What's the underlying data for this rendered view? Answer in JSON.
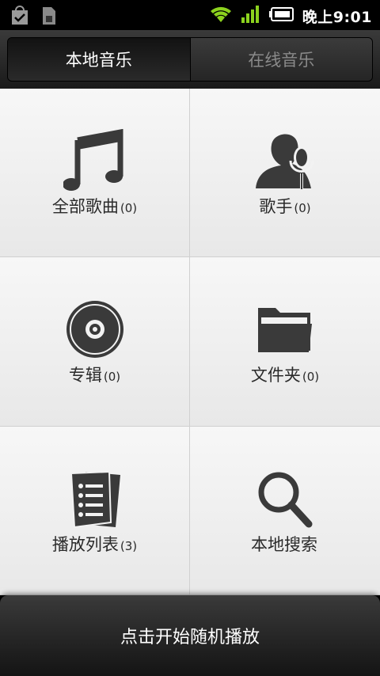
{
  "status_bar": {
    "time": "晚上9:01",
    "icons": [
      "shopping-bag-check-icon",
      "sim-card-icon",
      "wifi-icon",
      "signal-bars-icon",
      "battery-icon"
    ],
    "accent_color": "#8cd21e"
  },
  "tabs": [
    {
      "label": "本地音乐",
      "active": true
    },
    {
      "label": "在线音乐",
      "active": false
    }
  ],
  "grid": {
    "items": [
      {
        "label": "全部歌曲",
        "count": "(0)",
        "icon": "music-note-icon"
      },
      {
        "label": "歌手",
        "count": "(0)",
        "icon": "singer-microphone-icon"
      },
      {
        "label": "专辑",
        "count": "(0)",
        "icon": "disc-icon"
      },
      {
        "label": "文件夹",
        "count": "(0)",
        "icon": "folder-icon"
      },
      {
        "label": "播放列表",
        "count": "(3)",
        "icon": "playlist-icon"
      },
      {
        "label": "本地搜索",
        "count": "",
        "icon": "search-icon"
      }
    ]
  },
  "shuffle_bar": {
    "label": "点击开始随机播放"
  }
}
